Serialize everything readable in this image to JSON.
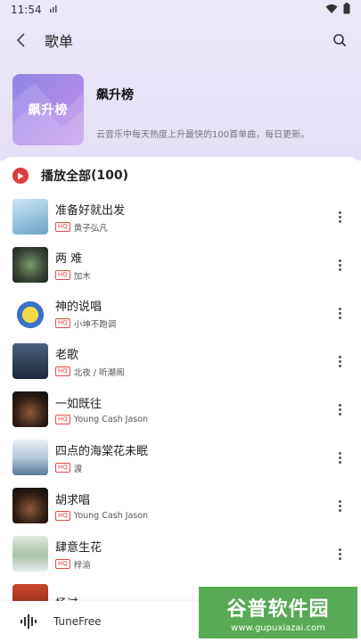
{
  "status": {
    "time": "11:54"
  },
  "appbar": {
    "title": "歌单"
  },
  "playlist": {
    "cover_text": "飙升榜",
    "name": "飙升榜",
    "description": "云音乐中每天热度上升最快的100首单曲，每日更新。"
  },
  "play_all": {
    "label": "播放全部",
    "count": "(100)"
  },
  "hq_label": "HQ",
  "songs": [
    {
      "title": "准备好就出发",
      "artist": "黄子弘凡"
    },
    {
      "title": "两 难",
      "artist": "加木"
    },
    {
      "title": "神的说唱",
      "artist": "小坤不跑调"
    },
    {
      "title": "老歌",
      "artist": "北夜 / 听潮阁"
    },
    {
      "title": "一如既往",
      "artist": "Young Cash Jason"
    },
    {
      "title": "四点的海棠花未眠",
      "artist": "渡"
    },
    {
      "title": "胡求唱",
      "artist": "Young Cash Jason"
    },
    {
      "title": "肆意生花",
      "artist": "梓渝"
    },
    {
      "title": "杨过",
      "artist": ""
    }
  ],
  "player": {
    "label": "TuneFree"
  },
  "watermark": {
    "big": "谷普软件园",
    "small": "www.gupuxiazai.com"
  },
  "colors": {
    "accent": "#e03a3a",
    "cover_start": "#8e86e6",
    "cover_end": "#c09ae8"
  }
}
